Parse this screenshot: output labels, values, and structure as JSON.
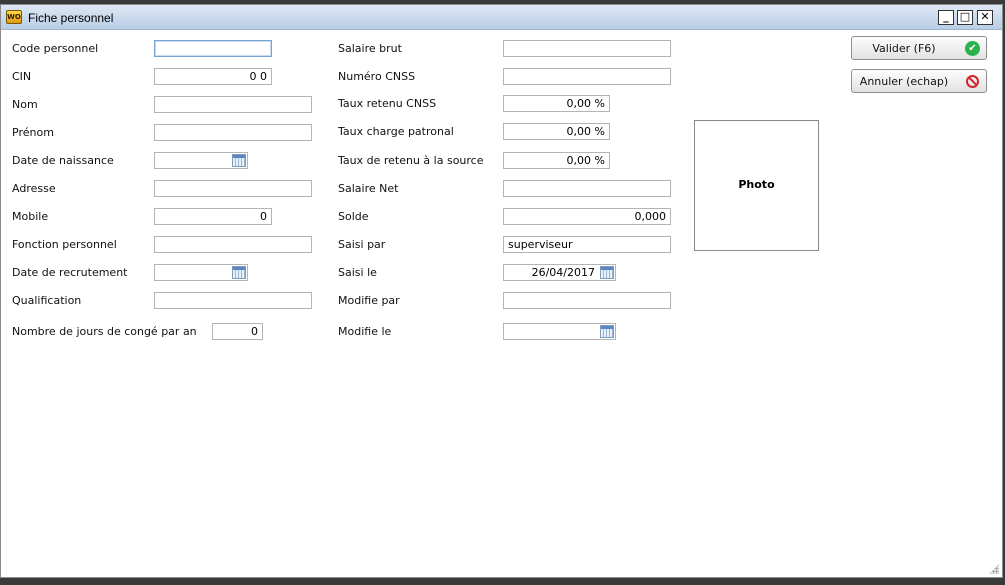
{
  "window": {
    "title": "Fiche personnel",
    "app_icon_text": "WO",
    "minimize": "_",
    "maximize": "□",
    "close": "✕"
  },
  "left": {
    "code_label": "Code personnel",
    "code_value": "",
    "cin_label": "CIN",
    "cin_value": "0  0",
    "nom_label": "Nom",
    "nom_value": "",
    "prenom_label": "Prénom",
    "prenom_value": "",
    "naissance_label": "Date de naissance",
    "naissance_value": "",
    "adresse_label": "Adresse",
    "adresse_value": "",
    "mobile_label": "Mobile",
    "mobile_value": "0",
    "fonction_label": "Fonction personnel",
    "fonction_value": "",
    "recrutement_label": "Date de recrutement",
    "recrutement_value": "",
    "qualification_label": "Qualification",
    "qualification_value": "",
    "conge_label": "Nombre de jours de congé par an",
    "conge_value": "0"
  },
  "middle": {
    "salaire_brut_label": "Salaire brut",
    "salaire_brut_value": "",
    "cnss_label": "Numéro CNSS",
    "cnss_value": "",
    "taux_cnss_label": "Taux retenu CNSS",
    "taux_cnss_value": "0,00 %",
    "taux_patronal_label": "Taux charge patronal",
    "taux_patronal_value": "0,00 %",
    "taux_source_label": "Taux de retenu à la source",
    "taux_source_value": "0,00 %",
    "salaire_net_label": "Salaire Net",
    "salaire_net_value": "",
    "solde_label": "Solde",
    "solde_value": "0,000",
    "saisi_par_label": "Saisi par",
    "saisi_par_value": "superviseur",
    "saisi_le_label": "Saisi le",
    "saisi_le_value": "26/04/2017",
    "modifie_par_label": "Modifie par",
    "modifie_par_value": "",
    "modifie_le_label": "Modifie le",
    "modifie_le_value": ""
  },
  "actions": {
    "valider_label": "Valider (F6)",
    "valider_icon": "check-circle-icon",
    "annuler_label": "Annuler (echap)",
    "annuler_icon": "no-entry-icon"
  },
  "photo": {
    "label": "Photo"
  },
  "colors": {
    "titlebar": "#c9d9ee",
    "ok_green": "#2bb24c",
    "cancel_red": "#d6222a",
    "focus_border": "#7aa1d0"
  }
}
